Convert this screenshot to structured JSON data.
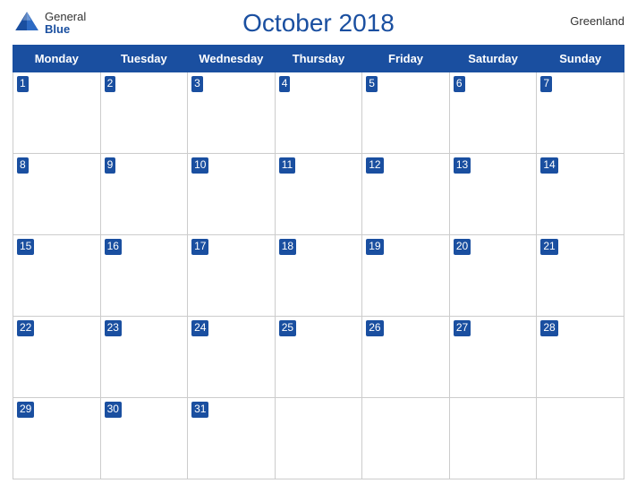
{
  "header": {
    "logo_general": "General",
    "logo_blue": "Blue",
    "title": "October 2018",
    "region": "Greenland"
  },
  "weekdays": [
    "Monday",
    "Tuesday",
    "Wednesday",
    "Thursday",
    "Friday",
    "Saturday",
    "Sunday"
  ],
  "weeks": [
    [
      {
        "day": 1
      },
      {
        "day": 2
      },
      {
        "day": 3
      },
      {
        "day": 4
      },
      {
        "day": 5
      },
      {
        "day": 6
      },
      {
        "day": 7
      }
    ],
    [
      {
        "day": 8
      },
      {
        "day": 9
      },
      {
        "day": 10
      },
      {
        "day": 11
      },
      {
        "day": 12
      },
      {
        "day": 13
      },
      {
        "day": 14
      }
    ],
    [
      {
        "day": 15
      },
      {
        "day": 16
      },
      {
        "day": 17
      },
      {
        "day": 18
      },
      {
        "day": 19
      },
      {
        "day": 20
      },
      {
        "day": 21
      }
    ],
    [
      {
        "day": 22
      },
      {
        "day": 23
      },
      {
        "day": 24
      },
      {
        "day": 25
      },
      {
        "day": 26
      },
      {
        "day": 27
      },
      {
        "day": 28
      }
    ],
    [
      {
        "day": 29
      },
      {
        "day": 30
      },
      {
        "day": 31
      },
      {
        "day": null
      },
      {
        "day": null
      },
      {
        "day": null
      },
      {
        "day": null
      }
    ]
  ]
}
